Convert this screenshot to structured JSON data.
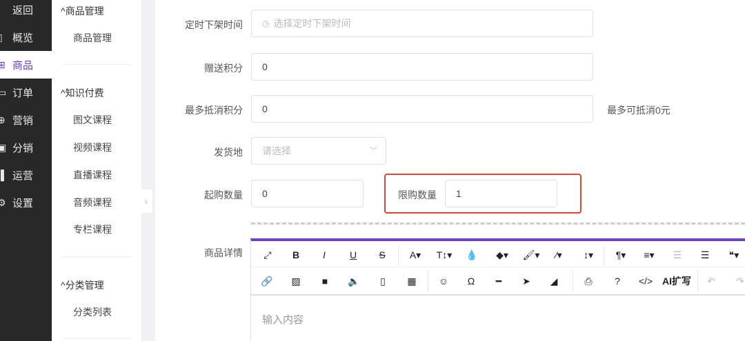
{
  "nav": [
    {
      "icon": "‹",
      "label": "返回"
    },
    {
      "icon": "▯",
      "label": "概览"
    },
    {
      "icon": "⊞",
      "label": "商品",
      "active": true
    },
    {
      "icon": "▭",
      "label": "订单"
    },
    {
      "icon": "⊕",
      "label": "营销"
    },
    {
      "icon": "▣",
      "label": "分销"
    },
    {
      "icon": "▐",
      "label": "运营"
    },
    {
      "icon": "⚙",
      "label": "设置"
    }
  ],
  "submenu": {
    "g1": "^商品管理",
    "g1_items": [
      "商品管理"
    ],
    "g2": "^知识付费",
    "g2_items": [
      "图文课程",
      "视频课程",
      "直播课程",
      "音频课程",
      "专栏课程"
    ],
    "g3": "^分类管理",
    "g3_items": [
      "分类列表"
    ]
  },
  "form": {
    "offshelf": {
      "label": "定时下架时间",
      "placeholder": "选择定时下架时间"
    },
    "points": {
      "label": "赠送积分",
      "value": "0"
    },
    "maxdeduct": {
      "label": "最多抵消积分",
      "value": "0",
      "hint": "最多可抵消0元"
    },
    "ship": {
      "label": "发货地",
      "placeholder": "请选择"
    },
    "minbuy": {
      "label": "起购数量",
      "value": "0"
    },
    "limit": {
      "label": "限购数量",
      "value": "1"
    },
    "detail": {
      "label": "商品详情",
      "placeholder": "输入内容"
    }
  },
  "toolbar": {
    "row1": [
      {
        "n": "fullscreen",
        "g": "⤢"
      },
      {
        "n": "bold",
        "g": "B"
      },
      {
        "n": "italic",
        "g": "I"
      },
      {
        "n": "underline",
        "g": "U"
      },
      {
        "n": "strikethrough",
        "g": "S"
      },
      {
        "n": "font-family",
        "g": "A▾"
      },
      {
        "n": "font-size",
        "g": "T↕▾"
      },
      {
        "n": "color",
        "g": "💧"
      },
      {
        "n": "tag",
        "g": "◆▾"
      },
      {
        "n": "paint",
        "g": "🖌▾"
      },
      {
        "n": "magic",
        "g": "⁄▾"
      },
      {
        "n": "line-height",
        "g": "↕▾"
      },
      {
        "n": "paragraph",
        "g": "¶▾"
      },
      {
        "n": "align",
        "g": "≡▾"
      },
      {
        "n": "outdent",
        "g": "☰"
      },
      {
        "n": "indent",
        "g": "☰"
      },
      {
        "n": "quote",
        "g": "❝▾"
      }
    ],
    "row2": [
      {
        "n": "link",
        "g": "🔗"
      },
      {
        "n": "image",
        "g": "▨"
      },
      {
        "n": "video",
        "g": "■"
      },
      {
        "n": "audio",
        "g": "🔈"
      },
      {
        "n": "file",
        "g": "▯"
      },
      {
        "n": "table",
        "g": "▦"
      },
      {
        "n": "emoji",
        "g": "☺"
      },
      {
        "n": "special-char",
        "g": "Ω"
      },
      {
        "n": "hr",
        "g": "━"
      },
      {
        "n": "select",
        "g": "➤"
      },
      {
        "n": "eraser",
        "g": "◢"
      },
      {
        "n": "print",
        "g": "⎙"
      },
      {
        "n": "help",
        "g": "?"
      },
      {
        "n": "code",
        "g": "</>"
      },
      {
        "n": "ai-expand",
        "g": "AI扩写"
      },
      {
        "n": "undo",
        "g": "↶"
      },
      {
        "n": "redo",
        "g": "↷"
      }
    ]
  }
}
